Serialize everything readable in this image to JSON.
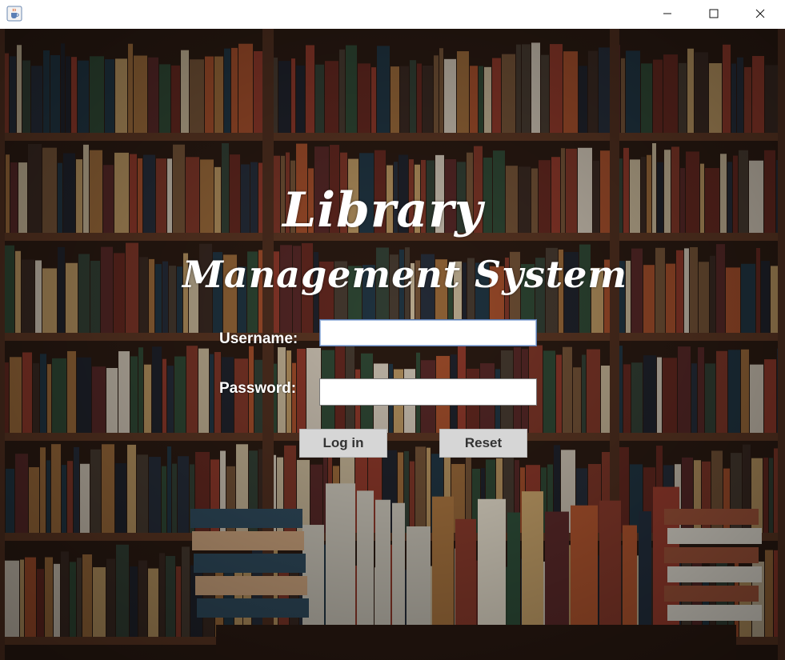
{
  "window": {
    "app_icon": "java-cup-icon",
    "controls": [
      "minimize-icon",
      "maximize-icon",
      "close-icon"
    ]
  },
  "login": {
    "title_line1": "Library",
    "title_line2": "Management System",
    "username_label": "Username:",
    "username_value": "",
    "password_label": "Password:",
    "password_value": "",
    "login_button": "Log in",
    "reset_button": "Reset"
  },
  "colors": {
    "text": "#ffffff",
    "button_bg": "#d6d6d6",
    "button_text": "#333333",
    "field_focus_border": "#5a7ab0",
    "shelf_wood": "#5b3623"
  }
}
